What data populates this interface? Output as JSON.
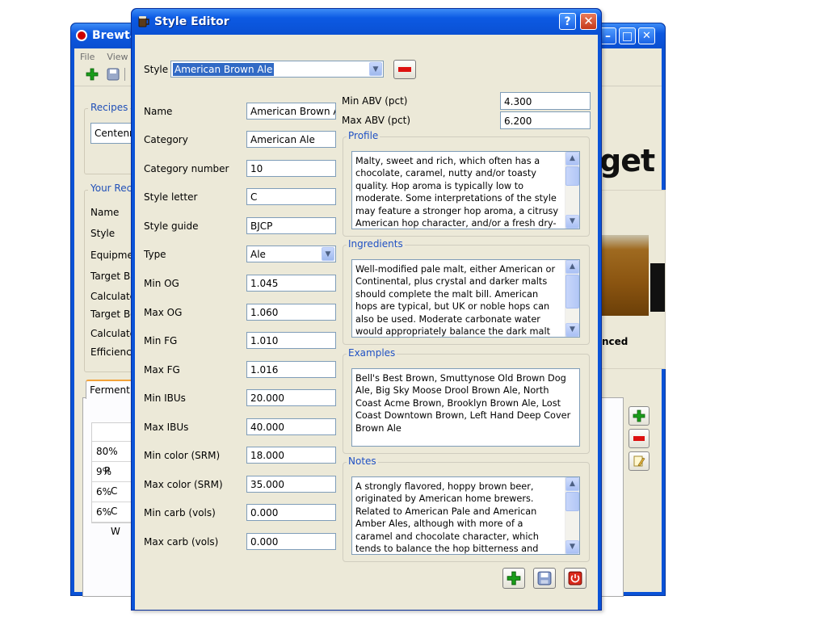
{
  "main_window": {
    "title": "Brewta",
    "menu": [
      "File",
      "View"
    ],
    "recipes_group_label": "Recipes",
    "recipe_select_value": "Centenn",
    "your_recipe_group_label": "Your Recip",
    "recipe_labels": [
      "Name",
      "Style",
      "Equipmen",
      "Target Ba",
      "Calculate",
      "Target Bo",
      "Calculate",
      "Efficiency"
    ],
    "logo_text": "get",
    "advanced_text": "nced",
    "tab_label": "Ferment",
    "fermentables": [
      {
        "pct": "80%",
        "name": "P"
      },
      {
        "pct": "9%",
        "name": "C"
      },
      {
        "pct": "6%",
        "name": "C"
      },
      {
        "pct": "6%",
        "name": "W"
      }
    ]
  },
  "dialog": {
    "title": "Style Editor",
    "help_label": "?",
    "close_label": "✕",
    "style_label": "Style",
    "style_value": "American Brown Ale",
    "fields": [
      {
        "label": "Name",
        "value": "American Brown Ale"
      },
      {
        "label": "Category",
        "value": "American Ale"
      },
      {
        "label": "Category number",
        "value": "10"
      },
      {
        "label": "Style letter",
        "value": "C"
      },
      {
        "label": "Style guide",
        "value": "BJCP"
      },
      {
        "label": "Type",
        "value": "Ale"
      },
      {
        "label": "Min OG",
        "value": "1.045"
      },
      {
        "label": "Max OG",
        "value": "1.060"
      },
      {
        "label": "Min FG",
        "value": "1.010"
      },
      {
        "label": "Max FG",
        "value": "1.016"
      },
      {
        "label": "Min IBUs",
        "value": "20.000"
      },
      {
        "label": "Max IBUs",
        "value": "40.000"
      },
      {
        "label": "Min color (SRM)",
        "value": "18.000"
      },
      {
        "label": "Max color (SRM)",
        "value": "35.000"
      },
      {
        "label": "Min carb (vols)",
        "value": "0.000"
      },
      {
        "label": "Max carb (vols)",
        "value": "0.000"
      }
    ],
    "min_abv_label": "Min ABV (pct)",
    "min_abv_value": "4.300",
    "max_abv_label": "Max ABV (pct)",
    "max_abv_value": "6.200",
    "profile_label": "Profile",
    "profile_text": "Malty, sweet and rich, which often has a chocolate, caramel, nutty and/or toasty quality. Hop aroma is typically low to moderate. Some interpretations of the style may feature a stronger hop aroma, a citrusy American hop character, and/or a fresh dry-hopped aroma (all",
    "ingredients_label": "Ingredients",
    "ingredients_text": "Well-modified pale malt, either American or Continental, plus crystal and darker malts should complete the malt bill. American hops are typical, but UK or noble hops can also be used. Moderate carbonate water would appropriately balance the dark malt acidity.",
    "examples_label": "Examples",
    "examples_text": "Bell's Best Brown, Smuttynose Old Brown Dog Ale, Big Sky Moose Drool Brown Ale, North Coast Acme Brown, Brooklyn Brown Ale, Lost Coast Downtown Brown, Left Hand Deep Cover Brown Ale",
    "notes_label": "Notes",
    "notes_text": "A strongly flavored, hoppy brown beer, originated by American home brewers. Related to American Pale and American Amber Ales, although with more of a caramel and chocolate character, which tends to balance the hop bitterness and finish. Most commercial American"
  },
  "colors": {
    "titlebar": "#0a53d8",
    "dialog_bg": "#ece9d8",
    "group_label": "#2051c4",
    "field_border": "#7f9db9"
  }
}
